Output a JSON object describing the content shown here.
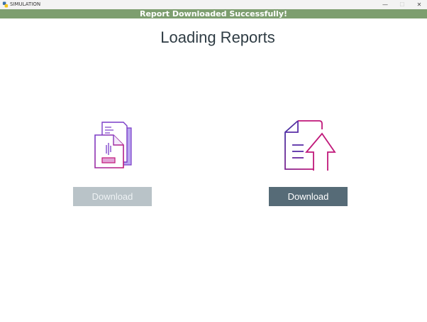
{
  "window": {
    "title": "SIMULATION",
    "icon": "python-icon",
    "controls": {
      "minimize": "—",
      "maximize": "☐",
      "close": "✕"
    }
  },
  "banner": {
    "text": "Report Downloaded Successfully!",
    "color": "#7d9e6f"
  },
  "page": {
    "heading": "Loading Reports"
  },
  "reports": [
    {
      "icon": "document-stack-icon",
      "button_label": "Download",
      "state": "disabled",
      "button_color": "#b9c3c8"
    },
    {
      "icon": "document-upload-icon",
      "button_label": "Download",
      "state": "enabled",
      "button_color": "#566b77"
    }
  ],
  "colors": {
    "heading": "#2f3c44",
    "icon_magenta": "#c0187a",
    "icon_purple": "#7a3dc8",
    "icon_lavender": "#b9a6ef"
  }
}
